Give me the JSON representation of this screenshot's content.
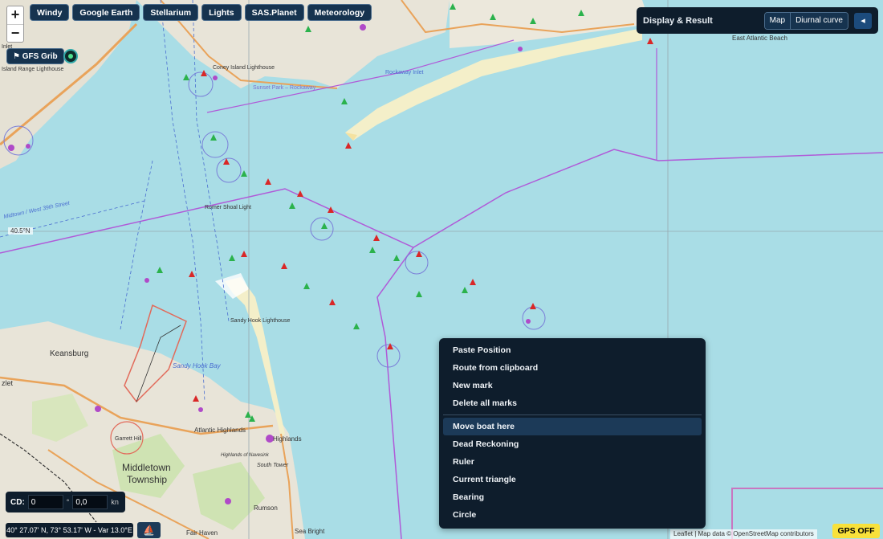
{
  "zoom": {
    "in": "+",
    "out": "−"
  },
  "toolbar": [
    "Windy",
    "Google Earth",
    "Stellarium",
    "Lights",
    "SAS.Planet",
    "Meteorology"
  ],
  "grib": {
    "label": "⚑ GFS Grib"
  },
  "display": {
    "title": "Display & Result",
    "tabs": [
      "Map",
      "Diurnal curve"
    ],
    "collapse": "◂"
  },
  "context_menu": {
    "group1": [
      "Paste Position",
      "Route from clipboard",
      "New mark",
      "Delete all marks"
    ],
    "group2": [
      "Move boat here",
      "Dead Reckoning",
      "Ruler",
      "Current triangle",
      "Bearing",
      "Circle"
    ]
  },
  "cd": {
    "label": "CD:",
    "value1": "0",
    "unit1": "°",
    "value2": "0,0",
    "unit2": "kn"
  },
  "coords": "40° 27.07' N, 73° 53.17' W - Var 13.0°E",
  "gps": "GPS OFF",
  "attribution": "Leaflet | Map data © OpenStreetMap contributors",
  "map_labels": {
    "coney": "Coney Island Lighthouse",
    "sunset": "Sunset Park – Rockaway",
    "rockaway_inlet": "Rockaway Inlet",
    "east_atlantic": "East Atlantic Beach",
    "romer": "Romer Shoal Light",
    "sandy_hook": "Sandy Hook Lighthouse",
    "sandy_hook_bay": "Sandy Hook Bay",
    "keansburg": "Keansburg",
    "atlantic_highlands": "Atlantic Highlands",
    "highlands": "Highlands",
    "middletown1": "Middletown",
    "middletown2": "Township",
    "rumson": "Rumson",
    "fair_haven": "Fair Haven",
    "sea_bright": "Sea Bright",
    "south_tower": "South Tower",
    "garrett": "Garrett Hill",
    "navesink": "Highlands of Navesink",
    "lat": "40.5°N",
    "midtown": "Midtown / West 39th Street",
    "inl": "Inlet",
    "island_range": "Island Range Lighthouse",
    "zlet": "zlet"
  }
}
